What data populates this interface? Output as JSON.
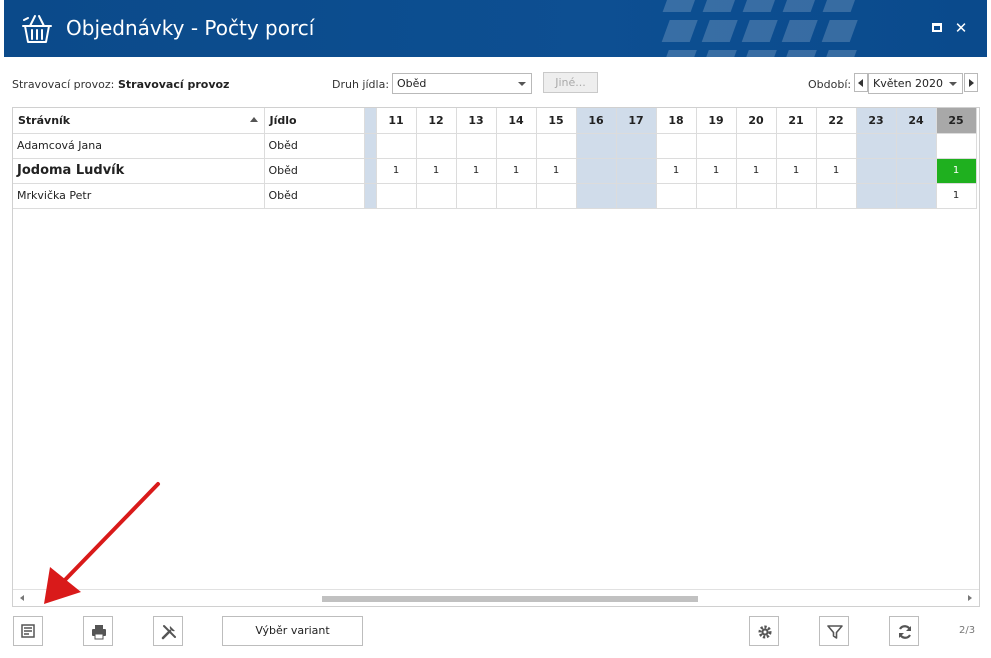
{
  "window": {
    "title": "Objednávky - Počty porcí"
  },
  "filters": {
    "provoz_label": "Stravovací provoz:",
    "provoz_value": "Stravovací provoz",
    "druh_label": "Druh jídla:",
    "druh_value": "Oběd",
    "jine_label": "Jiné...",
    "obdobi_label": "Období:",
    "obdobi_value": "Květen 2020"
  },
  "grid": {
    "col_stravnik": "Strávník",
    "col_jidlo": "Jídlo",
    "days": [
      "11",
      "12",
      "13",
      "14",
      "15",
      "16",
      "17",
      "18",
      "19",
      "20",
      "21",
      "22",
      "23",
      "24",
      "25"
    ],
    "rows": [
      {
        "name": "Adamcová Jana",
        "meal": "Oběd",
        "cells": [
          "",
          "",
          "",
          "",
          "",
          "",
          "",
          "",
          "",
          "",
          "",
          "",
          "",
          "",
          ""
        ]
      },
      {
        "name": "Jodoma Ludvík",
        "meal": "Oběd",
        "cells": [
          "1",
          "1",
          "1",
          "1",
          "1",
          "",
          "",
          "1",
          "1",
          "1",
          "1",
          "1",
          "",
          "",
          "1"
        ]
      },
      {
        "name": "Mrkvička Petr",
        "meal": "Oběd",
        "cells": [
          "",
          "",
          "",
          "",
          "",
          "",
          "",
          "",
          "",
          "",
          "",
          "",
          "",
          "",
          "1"
        ]
      }
    ]
  },
  "toolbar": {
    "variant_label": "Výběr variant",
    "pager": "2/3"
  },
  "colors": {
    "title_bg": "#0b4a8a",
    "weekend": "#d0dcea",
    "selected": "#1fb01f",
    "today_header": "#a8a8a8",
    "annotation": "#d91a1a"
  }
}
